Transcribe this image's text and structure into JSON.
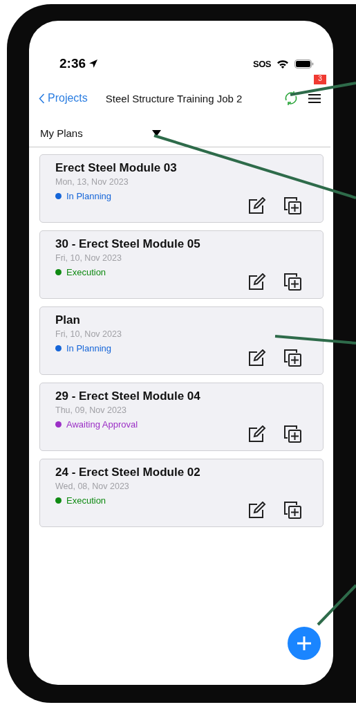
{
  "status_bar": {
    "time": "2:36",
    "carrier": "SOS"
  },
  "nav": {
    "back": "Projects",
    "title": "Steel Structure Training Job 2",
    "badge": "3"
  },
  "filter": {
    "label": "My Plans"
  },
  "plans": [
    {
      "title": "Erect Steel Module 03",
      "date": "Mon, 13, Nov 2023",
      "status": "In Planning",
      "color": "#1565d8"
    },
    {
      "title": "30 - Erect Steel Module 05",
      "date": "Fri, 10, Nov 2023",
      "status": "Execution",
      "color": "#0f8a12"
    },
    {
      "title": "Plan",
      "date": "Fri, 10, Nov 2023",
      "status": "In Planning",
      "color": "#1565d8"
    },
    {
      "title": "29 - Erect Steel Module 04",
      "date": "Thu, 09, Nov 2023",
      "status": "Awaiting Approval",
      "color": "#9b2fc6"
    },
    {
      "title": "24 - Erect Steel Module 02",
      "date": "Wed, 08, Nov 2023",
      "status": "Execution",
      "color": "#0f8a12"
    }
  ]
}
